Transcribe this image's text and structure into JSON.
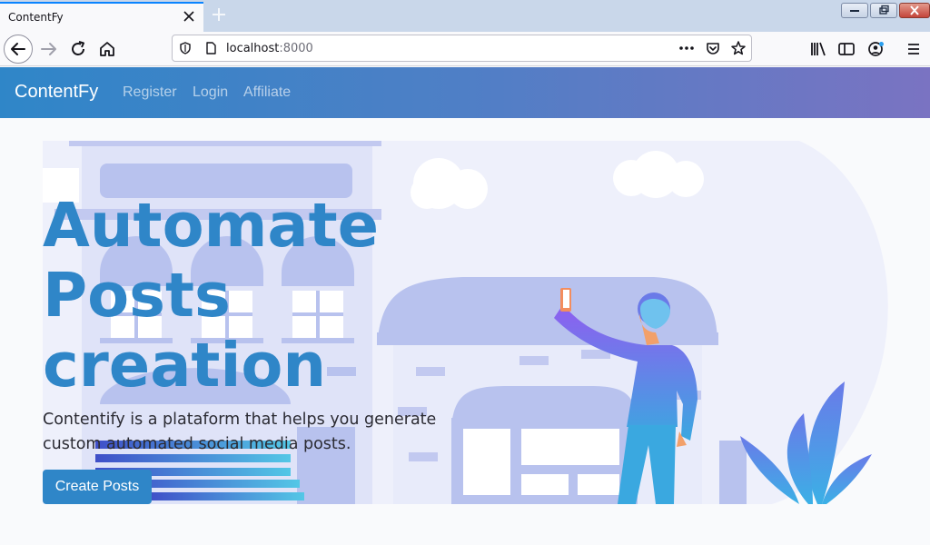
{
  "browser": {
    "tab_title": "ContentFy",
    "url_host": "localhost",
    "url_port": ":8000"
  },
  "site": {
    "brand": "ContentFy",
    "nav": [
      "Register",
      "Login",
      "Affiliate"
    ]
  },
  "hero": {
    "title_lines": [
      "Automate",
      "Posts",
      "creation"
    ],
    "subtitle_lines": [
      "Contentify is a plataform that helps you generate",
      "custom automated social media posts."
    ],
    "cta_label": "Create Posts"
  },
  "colors": {
    "accent": "#2f86c8",
    "nav_gradient_end": "#7a73c2",
    "illustration": "#b8c2ee"
  },
  "icons": [
    "close-icon",
    "plus-icon",
    "back-arrow-icon",
    "forward-arrow-icon",
    "reload-icon",
    "home-icon",
    "shield-icon",
    "page-icon",
    "more-icon",
    "pocket-icon",
    "star-icon",
    "library-icon",
    "sidebar-icon",
    "account-icon",
    "menu-icon"
  ]
}
